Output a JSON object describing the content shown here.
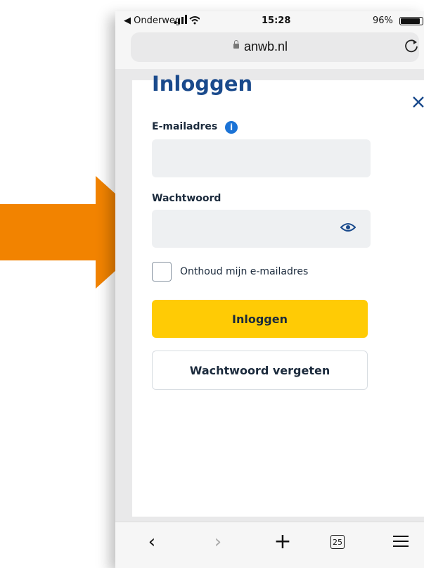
{
  "status_bar": {
    "carrier": "◀ Onderweg",
    "time": "15:28",
    "battery_text": "96%"
  },
  "browser": {
    "url": "anwb.nl"
  },
  "modal": {
    "title": "Inloggen",
    "email_label": "E-mailadres",
    "email_value": "",
    "info_icon": "i",
    "password_label": "Wachtwoord",
    "password_value": "",
    "remember_label": "Onthoud mijn e-mailadres",
    "remember_checked": false,
    "login_button": "Inloggen",
    "forgot_button": "Wachtwoord vergeten"
  },
  "toolbar": {
    "back": "‹",
    "forward": "›",
    "new_tab": "+",
    "tab_count": "25"
  },
  "colors": {
    "arrow": "#f28300",
    "title": "#1a4a8c",
    "primary_button": "#ffcb05",
    "info_icon": "#1b73d6",
    "input_bg": "#eef0f2"
  },
  "icons": [
    "arrow-right-icon",
    "signal-icon",
    "wifi-icon",
    "battery-icon",
    "lock-icon",
    "reload-icon",
    "close-icon",
    "info-icon",
    "eye-icon",
    "back-icon",
    "forward-icon",
    "plus-icon",
    "tabs-icon",
    "menu-icon"
  ]
}
